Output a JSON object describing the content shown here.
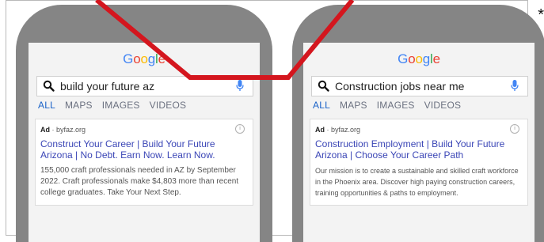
{
  "colors": {
    "phone_body": "#858585",
    "screen_bg": "#f3f3f3",
    "ad_title": "#3b46b6",
    "active_tab": "#1a62c8",
    "overlay_line": "#d4161e"
  },
  "google_logo": {
    "letters": [
      "G",
      "o",
      "o",
      "g",
      "l",
      "e"
    ],
    "letter_colors": [
      "#4285f4",
      "#ea4335",
      "#fbbc05",
      "#4285f4",
      "#34a853",
      "#ea4335"
    ]
  },
  "left": {
    "search": {
      "value": "build your future az"
    },
    "tabs": [
      "ALL",
      "MAPS",
      "IMAGES",
      "VIDEOS"
    ],
    "ad": {
      "label": "Ad",
      "domain": "· byfaz.org",
      "title": "Construct Your Career | Build Your Future Arizona | No Debt. Earn Now. Learn Now.",
      "description": "155,000 craft professionals needed in AZ by September 2022. Craft professionals make $4,803 more than recent college graduates. Take Your Next Step."
    }
  },
  "right": {
    "search": {
      "value": "Construction jobs near me"
    },
    "tabs": [
      "ALL",
      "MAPS",
      "IMAGES",
      "VIDEOS"
    ],
    "ad": {
      "label": "Ad",
      "domain": "· byfaz.org",
      "title": "Construction Employment | Build Your Future Arizona | Choose Your Career Path",
      "description": "Our mission is to create a sustainable and skilled craft workforce in the Phoenix area. Discover high paying construction careers, training opportunities & paths to employment."
    }
  },
  "corner_mark": "*"
}
